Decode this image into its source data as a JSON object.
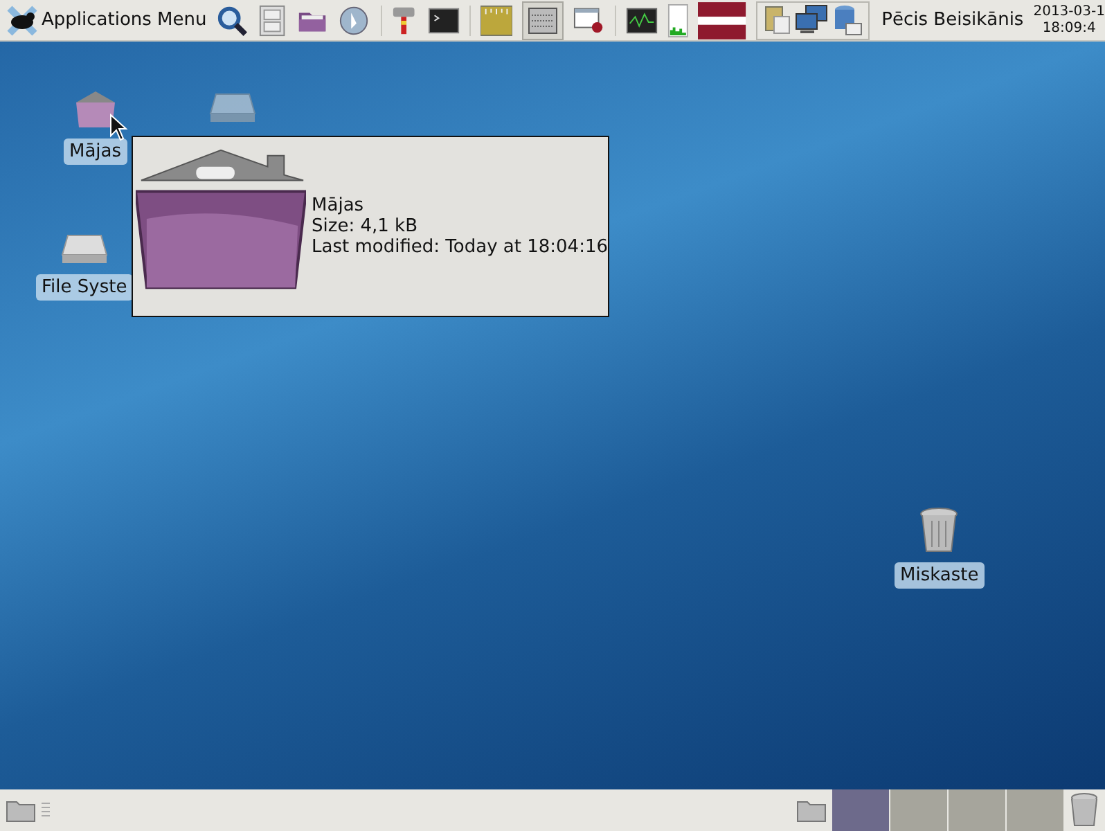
{
  "top_panel": {
    "applications_menu": "Applications Menu",
    "user": "Pēcis Beisikānis",
    "clock": [
      "2013-03-1",
      "18:09:4"
    ]
  },
  "desktop_icons": [
    {
      "kind": "home",
      "label": "Mājas"
    },
    {
      "kind": "drive"
    },
    {
      "kind": "drive",
      "label": "File Syste"
    },
    {
      "kind": "trash",
      "label": "Miskaste"
    }
  ],
  "tooltip": {
    "name": "Mājas",
    "size": "Size: 4,1 kB",
    "modified": "Last modified: Today at 18:04:16"
  },
  "bottom_panel": {
    "workspaces": [
      {
        "selected": true
      },
      {
        "selected": false
      },
      {
        "selected": false
      },
      {
        "selected": false
      }
    ]
  }
}
